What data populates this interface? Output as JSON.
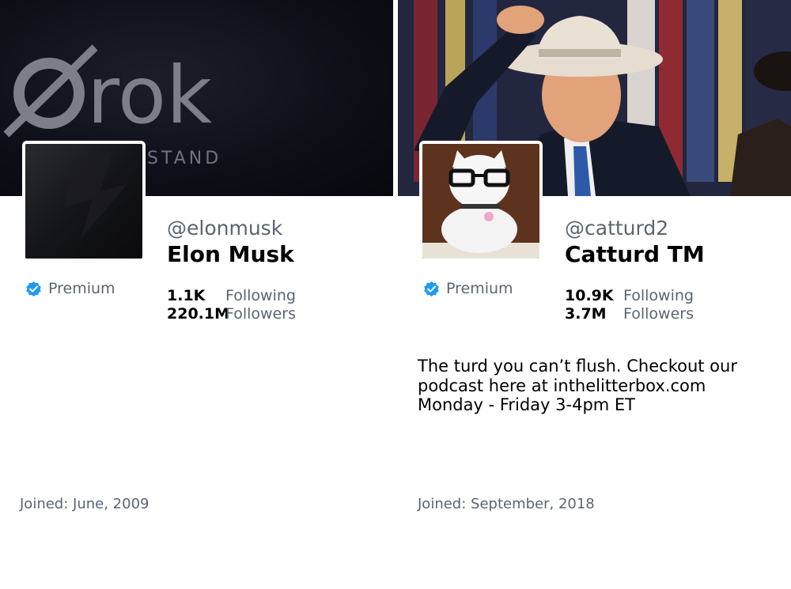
{
  "profiles": [
    {
      "banner": {
        "logo_text": "rok",
        "sub_text": "STAND"
      },
      "handle": "@elonmusk",
      "name": "Elon Musk",
      "badge": "Premium",
      "following_count": "1.1K",
      "following_label": "Following",
      "followers_count": "220.1M",
      "followers_label": "Followers",
      "bio": "",
      "joined": "Joined: June, 2009"
    },
    {
      "handle": "@catturd2",
      "name": "Catturd TM",
      "badge": "Premium",
      "following_count": "10.9K",
      "following_label": "Following",
      "followers_count": "3.7M",
      "followers_label": "Followers",
      "bio_lines": [
        "The turd you can’t flush. Checkout our",
        "podcast here at inthelitterbox.com",
        "Monday - Friday 3-4pm ET"
      ],
      "joined": "Joined: September, 2018"
    }
  ],
  "colors": {
    "verified_blue": "#1d9bf0",
    "muted_text": "#5b6570",
    "primary_text": "#000000"
  },
  "icons": {
    "verified": "verified-badge-icon"
  }
}
